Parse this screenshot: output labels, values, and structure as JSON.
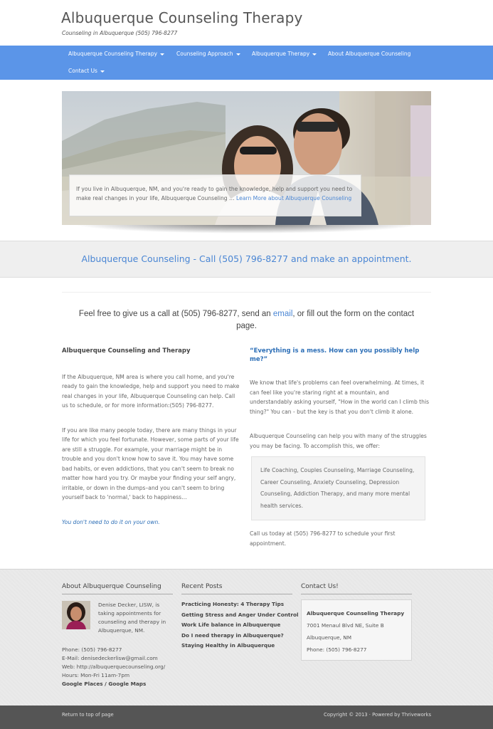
{
  "header": {
    "title": "Albuquerque Counseling Therapy",
    "tagline": "Counseling in Albuquerque (505) 796-8277"
  },
  "nav": {
    "items": [
      {
        "label": "Albuquerque Counseling Therapy",
        "dropdown": true
      },
      {
        "label": "Counseling Approach",
        "dropdown": true
      },
      {
        "label": "Albuquerque Therapy",
        "dropdown": true
      },
      {
        "label": "About Albuquerque Counseling",
        "dropdown": false
      },
      {
        "label": "Contact Us",
        "dropdown": true
      }
    ]
  },
  "hero": {
    "caption": "If you live in Albuquerque, NM, and you're ready to gain the knowledge, help and support you need to make real changes in your life, Albuquerque Counseling …",
    "learn_more": "Learn More about Albuquerque Counseling"
  },
  "cta": {
    "text": "Albuquerque Counseling - Call (505) 796-8277 and make an appointment."
  },
  "intro": {
    "before": "Feel free to give us a call at (505) 796-8277, send an ",
    "link": "email",
    "after": ", or fill out the form on the contact page."
  },
  "left_column": {
    "heading": "Albuquerque Counseling and Therapy",
    "p1": "If the Albuquerque, NM area is where you call home, and you're ready to gain the knowledge, help and support you need to make real changes in your life, Albuquerque Counseling can help. Call us to schedule, or for more information:(505) 796-8277.",
    "p2": "If you are like many people today, there are many things in your life for which you feel fortunate. However, some parts of your life are still a struggle. For example, your marriage might be in trouble and you don't know how to save it. You may have some bad habits, or even addictions, that you can't seem to break no matter how hard you try. Or maybe your finding your self angry, irritable, or down in the dumps–and you can't seem to bring yourself back to 'normal,' back to happiness…",
    "link": "You don't need to do it on your own."
  },
  "right_column": {
    "heading": "“Everything is a mess. How can you possibly help me?”",
    "p1": "We know that life's problems can feel overwhelming. At times, it can feel like you're staring right at a mountain, and understandably asking yourself, \"How in the world can I climb this thing?\" You can - but the key is that you don't climb it alone.",
    "p2": "Albuquerque Counseling can help you with many of the struggles you may be facing. To accomplish this, we offer:",
    "services": "Life Coaching, Couples Counseling, Marriage Counseling, Career Counseling, Anxiety Counseling, Depression Counseling, Addiction Therapy, and many more mental health services.",
    "p3": "Call us today at (505) 796-8277 to schedule your first appointment."
  },
  "footer": {
    "about": {
      "heading": "About Albuquerque Counseling",
      "bio": "Denise Decker, LISW, is taking appointments for counseling and therapy in Albuquerque, NM.",
      "phone": "Phone: (505) 796-8277",
      "email": "E-Mail: denisedeckerlisw@gmail.com",
      "web": "Web: http://albuquerquecounseling.org/",
      "hours": "Hours: Mon-Fri 11am-7pm",
      "places": "Google Places / Google Maps"
    },
    "recent": {
      "heading": "Recent Posts",
      "posts": [
        "Practicing Honesty: 4 Therapy Tips",
        "Getting Stress and Anger Under Control",
        "Work Life balance in Albuquerque",
        "Do I need therapy in Albuquerque?",
        "Staying Healthy in Albuquerque"
      ]
    },
    "contact": {
      "heading": "Contact Us!",
      "name": "Albuquerque Counseling Therapy",
      "street": "7001 Menaul Blvd NE, Suite B",
      "city": "Albuquerque, NM",
      "phone": "Phone: (505) 796-8277"
    }
  },
  "bottom": {
    "back_to_top": "Return to top of page",
    "copyright": "Copyright © 2013 · Powered by Thriveworks"
  },
  "colors": {
    "nav_bg": "#5b95e8",
    "accent": "#4a86d4",
    "link_dark": "#2d6fb7",
    "bottom_bar": "#555555"
  }
}
